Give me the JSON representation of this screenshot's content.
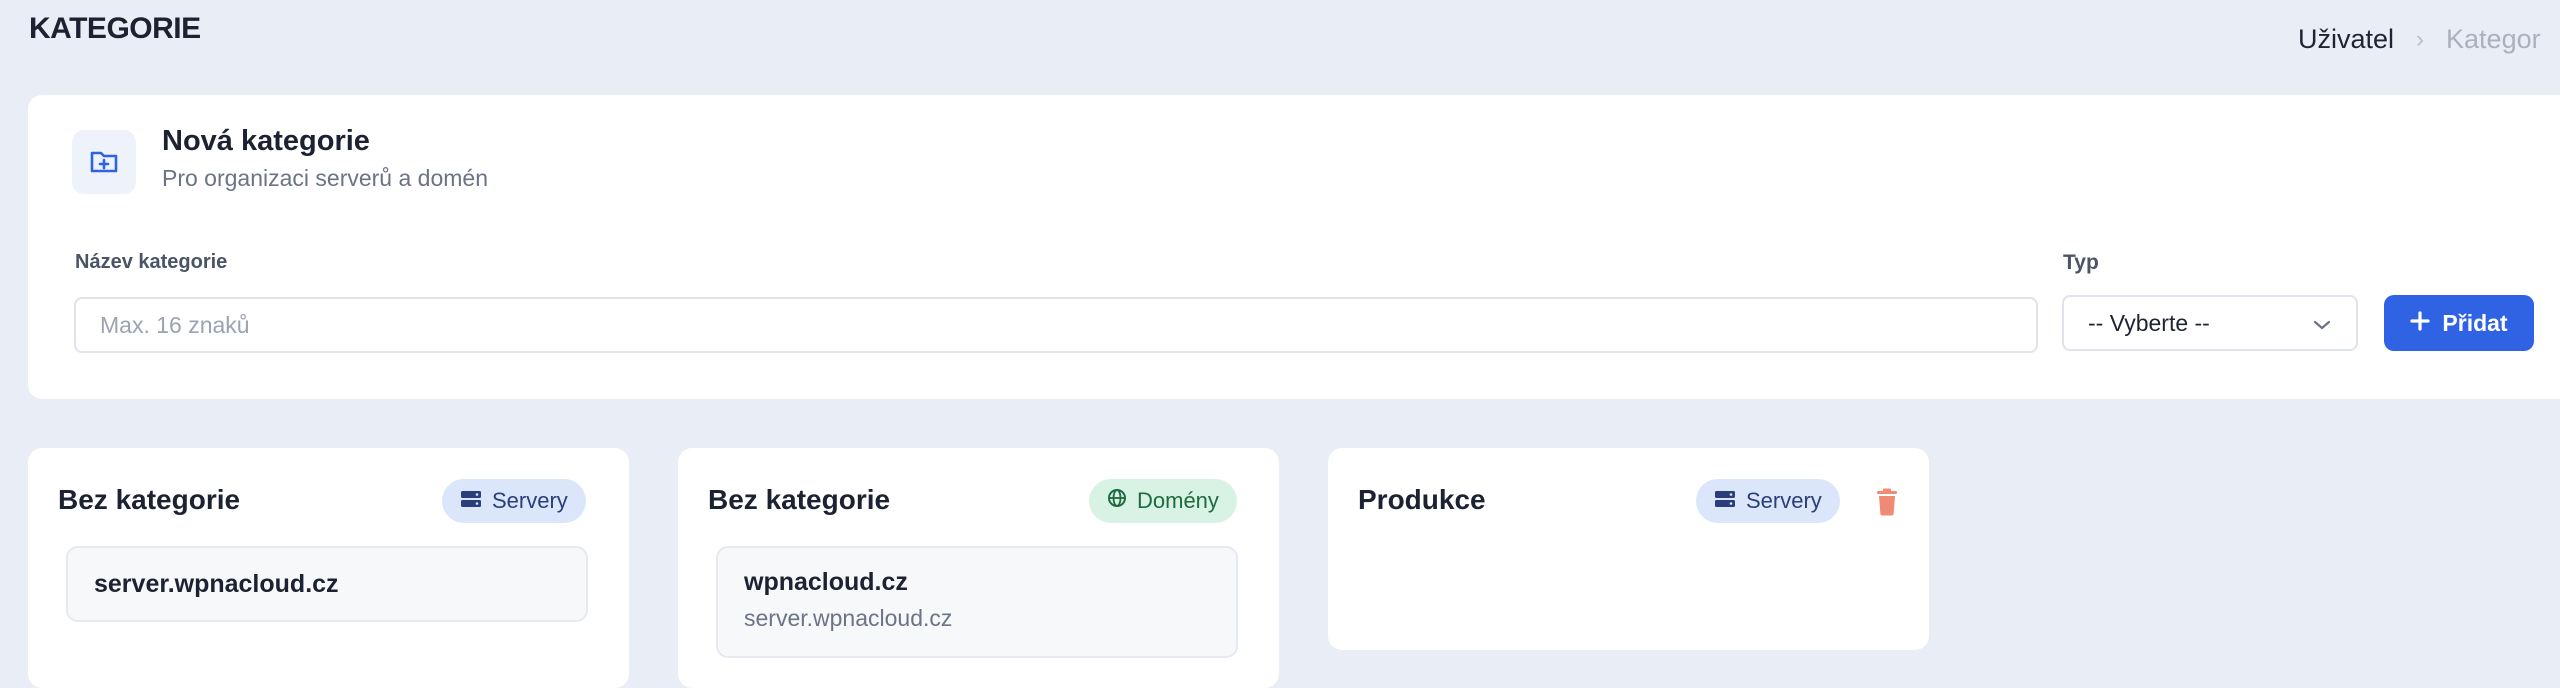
{
  "page": {
    "title": "KATEGORIE"
  },
  "breadcrumb": {
    "items": [
      "Uživatel",
      "Kategor"
    ]
  },
  "new_category": {
    "title": "Nová kategorie",
    "subtitle": "Pro organizaci serverů a domén",
    "name_label": "Název kategorie",
    "name_value": "",
    "name_placeholder": "Max. 16 znaků",
    "type_label": "Typ",
    "type_selected": "-- Vyberte --",
    "add_label": "Přidat",
    "icon": "folder-plus-icon"
  },
  "categories": [
    {
      "title": "Bez kategorie",
      "badge": "Servery",
      "badge_icon": "server-icon",
      "items": [
        {
          "main": "server.wpnacloud.cz"
        }
      ]
    },
    {
      "title": "Bez kategorie",
      "badge": "Domény",
      "badge_icon": "globe-icon",
      "items": [
        {
          "main": "wpnacloud.cz",
          "sub": "server.wpnacloud.cz"
        }
      ]
    },
    {
      "title": "Produkce",
      "badge": "Servery",
      "badge_icon": "server-icon",
      "delete_icon": "trash-icon",
      "items": []
    }
  ],
  "colors": {
    "background": "#e9edf5",
    "accent": "#2f63e4",
    "servers_badge": "#dbe6fb",
    "domains_badge": "#d8f3e4",
    "delete": "#ef8b74"
  }
}
